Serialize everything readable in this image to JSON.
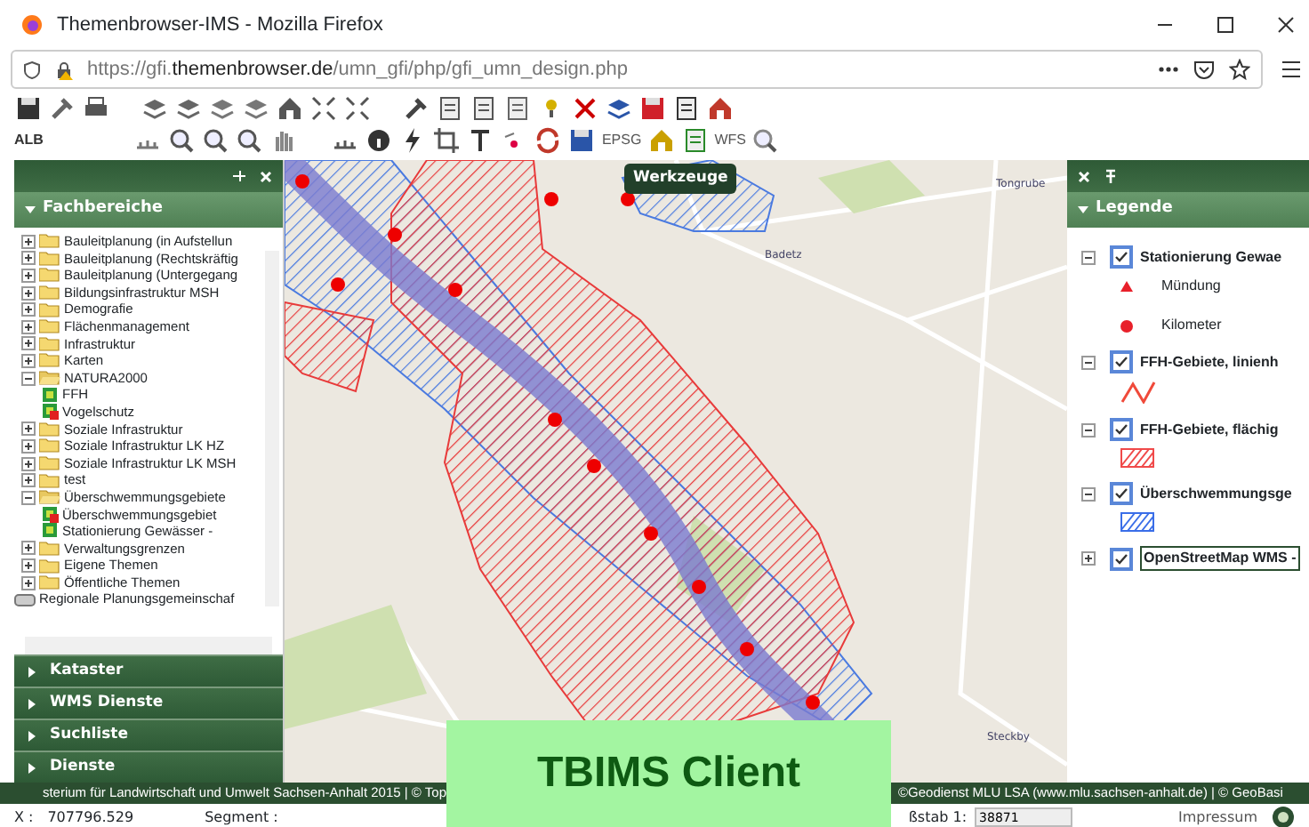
{
  "window": {
    "title": "Themenbrowser-IMS - Mozilla Firefox"
  },
  "address_bar": {
    "prefix": "https://gfi.",
    "domain": "themenbrowser.de",
    "path": "/umn_gfi/php/gfi_umn_design.php"
  },
  "toolbar": {
    "labels": [
      "ALB",
      "EPSG",
      "WFS"
    ]
  },
  "left_panel": {
    "section": "Fachbereiche",
    "expanded": true,
    "tree": [
      {
        "label": "Bauleitplanung (in Aufstellun",
        "kind": "folder",
        "expanded": false
      },
      {
        "label": "Bauleitplanung (Rechtskräftig",
        "kind": "folder",
        "expanded": false
      },
      {
        "label": "Bauleitplanung (Untergegang",
        "kind": "folder",
        "expanded": false
      },
      {
        "label": "Bildungsinfrastruktur MSH",
        "kind": "folder",
        "expanded": false
      },
      {
        "label": "Demografie",
        "kind": "folder",
        "expanded": false
      },
      {
        "label": "Flächenmanagement",
        "kind": "folder",
        "expanded": false
      },
      {
        "label": "Infrastruktur",
        "kind": "folder",
        "expanded": false
      },
      {
        "label": "Karten",
        "kind": "folder",
        "expanded": false
      },
      {
        "label": "NATURA2000",
        "kind": "folder",
        "expanded": true,
        "children": [
          {
            "label": "FFH",
            "kind": "layer",
            "out_of_scale": false
          },
          {
            "label": "Vogelschutz",
            "kind": "layer",
            "out_of_scale": true
          }
        ]
      },
      {
        "label": "Soziale Infrastruktur",
        "kind": "folder",
        "expanded": false
      },
      {
        "label": "Soziale Infrastruktur LK HZ",
        "kind": "folder",
        "expanded": false
      },
      {
        "label": "Soziale Infrastruktur LK MSH",
        "kind": "folder",
        "expanded": false
      },
      {
        "label": "test",
        "kind": "folder",
        "expanded": false
      },
      {
        "label": "Überschwemmungsgebiete",
        "kind": "folder",
        "expanded": true,
        "children": [
          {
            "label": "Überschwemmungsgebiet",
            "kind": "layer",
            "out_of_scale": true
          },
          {
            "label": "Stationierung Gewässer -",
            "kind": "layer",
            "out_of_scale": false
          }
        ]
      },
      {
        "label": "Verwaltungsgrenzen",
        "kind": "folder",
        "expanded": false
      },
      {
        "label": "Eigene Themen",
        "kind": "folder",
        "expanded": false
      },
      {
        "label": "Öffentliche Themen",
        "kind": "folder",
        "expanded": false
      }
    ],
    "group": "Regionale Planungsgemeinschaf",
    "accordion": [
      "Kataster",
      "WMS Dienste",
      "Suchliste",
      "Dienste"
    ]
  },
  "map": {
    "tooltip": "Werkzeuge",
    "places": [
      {
        "label": "Tongrube",
        "kind": "town"
      },
      {
        "label": "Badetz",
        "kind": "town"
      },
      {
        "label": "Steckby",
        "kind": "town"
      }
    ]
  },
  "legend": {
    "title": "Legende",
    "items": [
      {
        "label": "Stationierung Gewae",
        "checked": true,
        "expanded": true,
        "symbols": [
          {
            "kind": "triangle",
            "label": "Mündung",
            "color": "#e8202a"
          },
          {
            "kind": "dot",
            "label": "Kilometer",
            "color": "#e8202a"
          }
        ]
      },
      {
        "label": "FFH-Gebiete, linienh",
        "checked": true,
        "expanded": true,
        "symbols": [
          {
            "kind": "zigzag",
            "color": "#f04a3a"
          }
        ]
      },
      {
        "label": "FFH-Gebiete, flächig",
        "checked": true,
        "expanded": true,
        "symbols": [
          {
            "kind": "hatch",
            "color": "#f04a4a"
          }
        ]
      },
      {
        "label": "Überschwemmungsge",
        "checked": true,
        "expanded": true,
        "symbols": [
          {
            "kind": "hatch",
            "color": "#3a6ee8"
          }
        ]
      },
      {
        "label": "OpenStreetMap WMS -",
        "checked": true,
        "expanded": false
      }
    ]
  },
  "banner": {
    "text": "TBIMS Client"
  },
  "copyright": {
    "left": "sterium für Landwirtschaft und Umwelt Sachsen-Anhalt 2015 | © Top",
    "right": "©Geodienst MLU LSA (www.mlu.sachsen-anhalt.de) | © GeoBasi"
  },
  "status": {
    "x_label": "X :",
    "x_value": "707796.529",
    "segment": "Segment :",
    "scale_label": "ßstab 1:",
    "scale_value": "38871",
    "link": "Impressum"
  }
}
